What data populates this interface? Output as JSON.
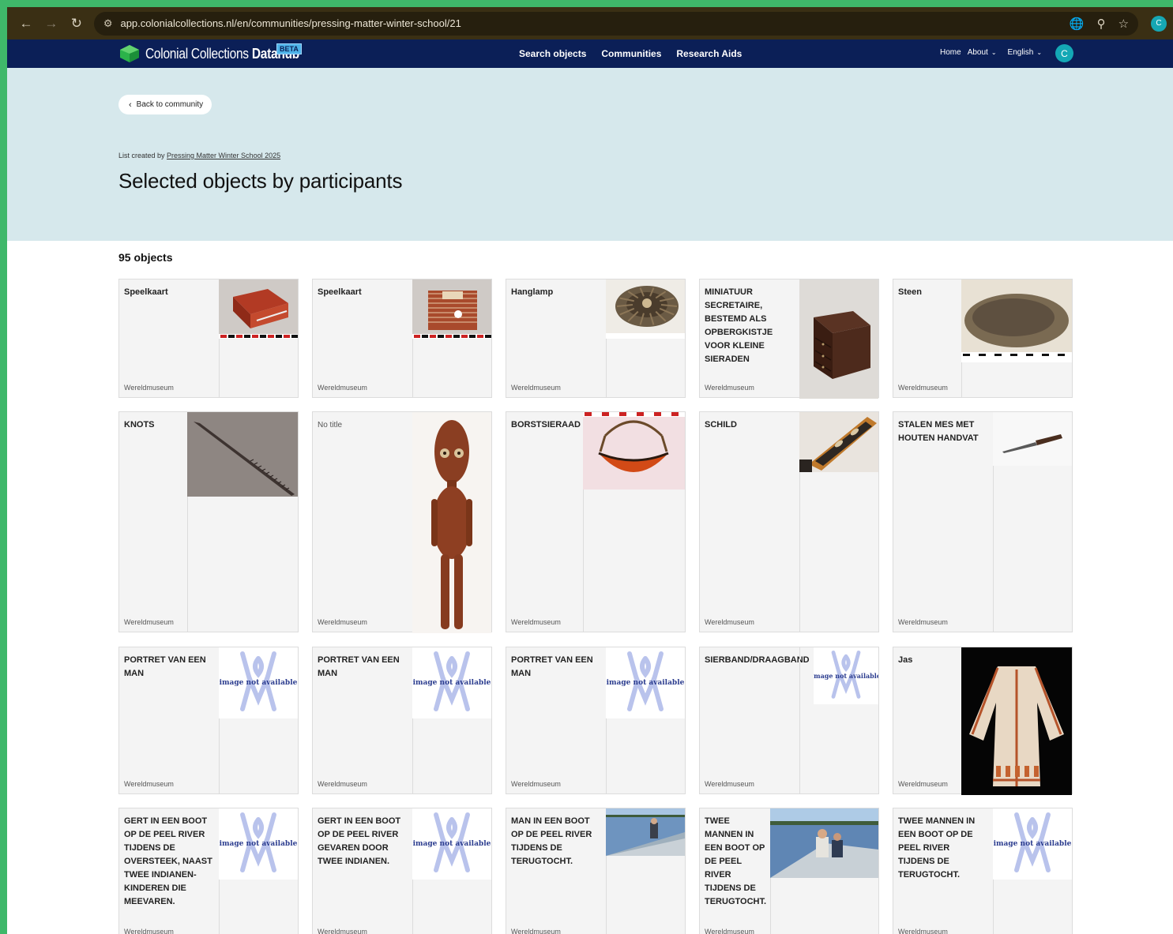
{
  "browser": {
    "url": "app.colonialcollections.nl/en/communities/pressing-matter-winter-school/21",
    "profile_initial": "C"
  },
  "header": {
    "brand_prefix": "Colonial Collections ",
    "brand_bold": "Datahub",
    "beta": "BETA",
    "nav": [
      "Search objects",
      "Communities",
      "Research Aids"
    ],
    "home": "Home",
    "about": "About",
    "language": "English",
    "user_initial": "C"
  },
  "hero": {
    "back_label": "Back to community",
    "created_prefix": "List created by ",
    "created_by": "Pressing Matter Winter School 2025",
    "title": "Selected objects by participants"
  },
  "results": {
    "count": "95 objects",
    "museum": "Wereldmuseum",
    "no_image_text": "image not available",
    "objects": [
      {
        "title": "Speelkaart",
        "image": "speelkaart-1-photo"
      },
      {
        "title": "Speelkaart",
        "image": "speelkaart-2-photo"
      },
      {
        "title": "Hanglamp",
        "image": "hanglamp-photo"
      },
      {
        "title": "MINIATUUR SECRETAIRE, BESTEMD ALS OPBERGKISTJE VOOR KLEINE SIERADEN",
        "image": "secretaire-photo"
      },
      {
        "title": "Steen",
        "image": "steen-photo"
      },
      {
        "title": "KNOTS",
        "image": "knots-photo"
      },
      {
        "title": "No title",
        "image": "figure-photo"
      },
      {
        "title": "BORSTSIERAAD",
        "image": "borstsieraad-photo"
      },
      {
        "title": "SCHILD",
        "image": "schild-photo"
      },
      {
        "title": "STALEN MES MET HOUTEN HANDVAT",
        "image": "mes-photo"
      },
      {
        "title": "PORTRET VAN EEN MAN",
        "image": "none"
      },
      {
        "title": "PORTRET VAN EEN MAN",
        "image": "none"
      },
      {
        "title": "PORTRET VAN EEN MAN",
        "image": "none"
      },
      {
        "title": "SIERBAND/DRAAGBAND",
        "image": "none"
      },
      {
        "title": "Jas",
        "image": "jas-photo"
      },
      {
        "title": "GERT IN EEN BOOT OP DE PEEL RIVER TIJDENS DE OVERSTEEK, NAAST TWEE INDIANEN-KINDEREN DIE MEEVAREN.",
        "image": "none"
      },
      {
        "title": "GERT IN EEN BOOT OP DE PEEL RIVER GEVAREN DOOR TWEE INDIANEN.",
        "image": "none"
      },
      {
        "title": "MAN IN EEN BOOT OP DE PEEL RIVER TIJDENS DE TERUGTOCHT.",
        "image": "boat-1-photo"
      },
      {
        "title": "TWEE MANNEN IN EEN BOOT OP DE PEEL RIVER TIJDENS DE TERUGTOCHT.",
        "image": "boat-2-photo"
      },
      {
        "title": "TWEE MANNEN IN EEN BOOT OP DE PEEL RIVER TIJDENS DE TERUGTOCHT.",
        "image": "none"
      }
    ]
  }
}
